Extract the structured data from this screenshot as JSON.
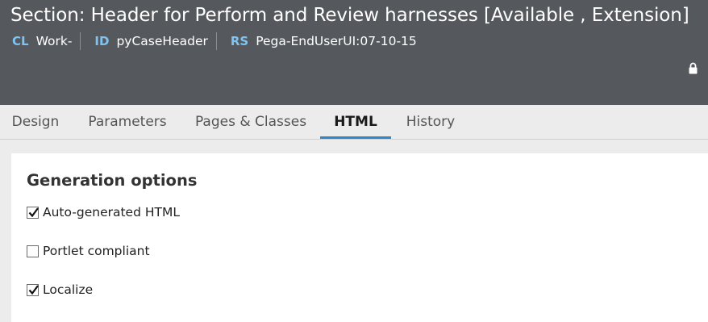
{
  "header": {
    "title": "Section: Header for Perform and Review harnesses [Available , Extension]",
    "meta": [
      {
        "key": "CL",
        "value": "Work-"
      },
      {
        "key": "ID",
        "value": "pyCaseHeader"
      },
      {
        "key": "RS",
        "value": "Pega-EndUserUI:07-10-15"
      }
    ],
    "lock_icon": "lock-icon"
  },
  "tabs": [
    {
      "label": "Design",
      "active": false
    },
    {
      "label": "Parameters",
      "active": false
    },
    {
      "label": "Pages & Classes",
      "active": false
    },
    {
      "label": "HTML",
      "active": true
    },
    {
      "label": "History",
      "active": false
    }
  ],
  "generation": {
    "title": "Generation options",
    "options": [
      {
        "label": "Auto-generated HTML",
        "checked": true
      },
      {
        "label": "Portlet compliant",
        "checked": false
      },
      {
        "label": "Localize",
        "checked": true
      }
    ]
  },
  "colors": {
    "header_bg": "#55585c",
    "meta_key": "#7fc4f0",
    "active_tab_underline": "#2f86c8"
  }
}
